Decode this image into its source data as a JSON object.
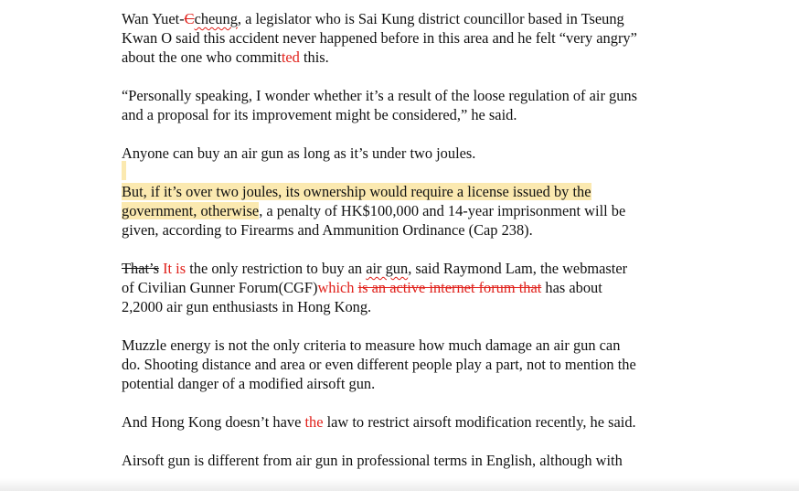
{
  "p1": {
    "l1_a": "Wan Yuet-",
    "l1_del": "C",
    "l1_squig": "cheung",
    "l1_b": ", a legislator who is Sai Kung district councillor based in Tseung",
    "l2": "Kwan O said this accident never happened before in this area and he felt “very angry”",
    "l3_a": "about the one who commit",
    "l3_ins": "ted",
    "l3_b": " this."
  },
  "p2": {
    "l1": "“Personally speaking, I wonder whether it’s a result of the loose regulation of air guns",
    "l2": "and a proposal for its improvement might be considered,” he said."
  },
  "p3": {
    "l1": "Anyone can buy an air gun as long as it’s under two joules."
  },
  "p4": {
    "l1": "But, if it’s over two joules, its ownership would require a license issued by the",
    "l2_hl": "government, otherwise",
    "l2_b": ", a penalty of HK$100,000 and 14-year imprisonment will be",
    "l3": "given, according to Firearms and Ammunition Ordinance (Cap 238)."
  },
  "p5": {
    "l1_del": "That’s",
    "l1_ins": " It is",
    "l1_a": " the only restriction to buy an ",
    "l1_squig": "air gun",
    "l1_b": ", said Raymond Lam, the webmaster",
    "l2_a": "of Civilian Gunner Forum(CGF)",
    "l2_ins": "which ",
    "l2_del": "is an active internet forum that",
    "l2_b": " has about",
    "l3": "2,2000 air gun enthusiasts in Hong Kong."
  },
  "p6": {
    "l1": "Muzzle energy is not the only criteria to measure how much damage an air gun can",
    "l2": "do. Shooting distance and area or even different people play a part, not to mention the",
    "l3": "potential danger of a modified airsoft gun."
  },
  "p7": {
    "l1_a": "And Hong Kong doesn’t have ",
    "l1_ins": "the",
    "l1_b": " law to restrict airsoft modification recently, he said."
  },
  "p8": {
    "l1": "Airsoft gun is different from air gun in professional terms in English, although with"
  }
}
